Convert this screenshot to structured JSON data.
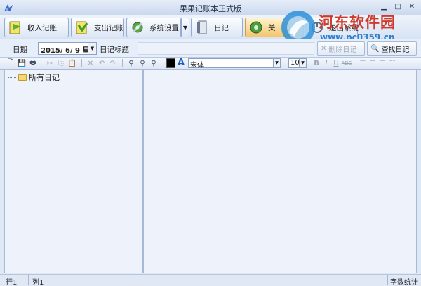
{
  "window": {
    "title": "果果记账本正式版"
  },
  "main_toolbar": {
    "income_label": "收入记账",
    "expense_label": "支出记账",
    "settings_label": "系统设置",
    "diary_label": "日记",
    "active_label": "关",
    "exit_label": "退出系统"
  },
  "watermark": {
    "title": "河东软件园",
    "url": "www.pc0359.cn"
  },
  "diary_bar": {
    "date_label": "日期",
    "date_value": "2015/  6/  9 星期",
    "title_label": "日记标题",
    "title_value": "",
    "delete_label": "删除日记",
    "search_label": "查找日记"
  },
  "format_toolbar": {
    "font_name": "宋体",
    "font_size": "10",
    "text_color": "#000000"
  },
  "tree": {
    "root_label": "所有日记"
  },
  "status": {
    "row": "行1",
    "col": "列1",
    "word_count": "字数统计"
  },
  "colors": {
    "accent": "#1b5fb8",
    "window_bg": "#dfe8f5",
    "pane_bg": "#eef3fb"
  }
}
